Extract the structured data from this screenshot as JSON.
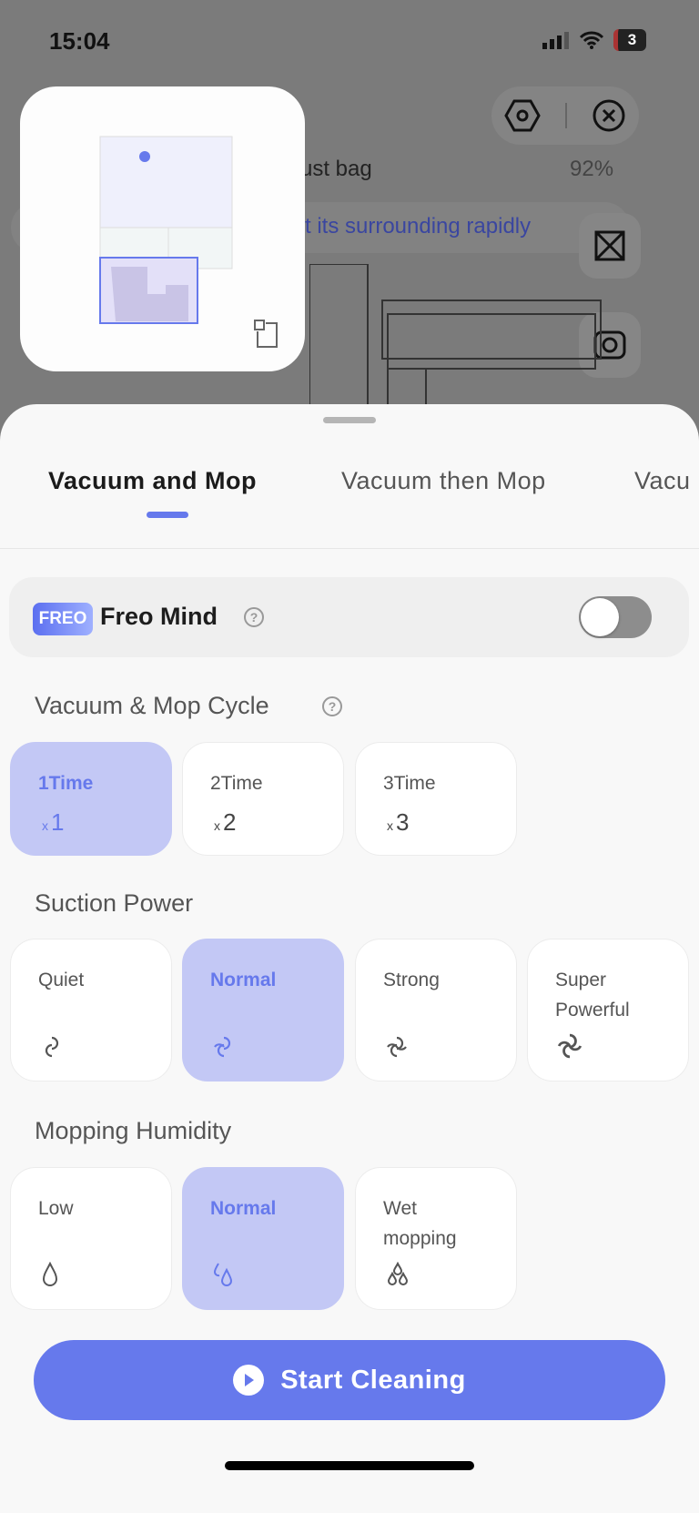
{
  "status_bar": {
    "time": "15:04",
    "battery": "3"
  },
  "map_bg": {
    "dust_bag_text": "ust bag",
    "battery_percent": "92%",
    "banner_text": "t its surrounding rapidly"
  },
  "tabs": [
    {
      "label": "Vacuum and Mop",
      "active": true
    },
    {
      "label": "Vacuum then Mop"
    },
    {
      "label": "Vacu"
    }
  ],
  "freo": {
    "badge": "FREO",
    "label": "Freo Mind",
    "help": "?",
    "enabled": false
  },
  "cycle": {
    "title": "Vacuum & Mop Cycle",
    "help": "?",
    "options": [
      {
        "label": "1Time",
        "mult": "x",
        "value": "1",
        "selected": true
      },
      {
        "label": "2Time",
        "mult": "x",
        "value": "2"
      },
      {
        "label": "3Time",
        "mult": "x",
        "value": "3"
      }
    ]
  },
  "suction": {
    "title": "Suction Power",
    "options": [
      {
        "label": "Quiet",
        "icon": "fan-1-icon"
      },
      {
        "label": "Normal",
        "icon": "fan-2-icon",
        "selected": true
      },
      {
        "label": "Strong",
        "icon": "fan-3-icon"
      },
      {
        "label": "Super Powerful",
        "icon": "fan-4-icon"
      }
    ]
  },
  "humidity": {
    "title": "Mopping Humidity",
    "options": [
      {
        "label": "Low",
        "icon": "drop-1-icon"
      },
      {
        "label": "Normal",
        "icon": "drop-2-icon",
        "selected": true
      },
      {
        "label": "Wet mopping",
        "icon": "drop-3-icon"
      }
    ]
  },
  "start_button": "Start Cleaning",
  "colors": {
    "accent": "#6679ec",
    "selected_bg": "#c3c8f5",
    "overlay": "#7b7b7b"
  }
}
